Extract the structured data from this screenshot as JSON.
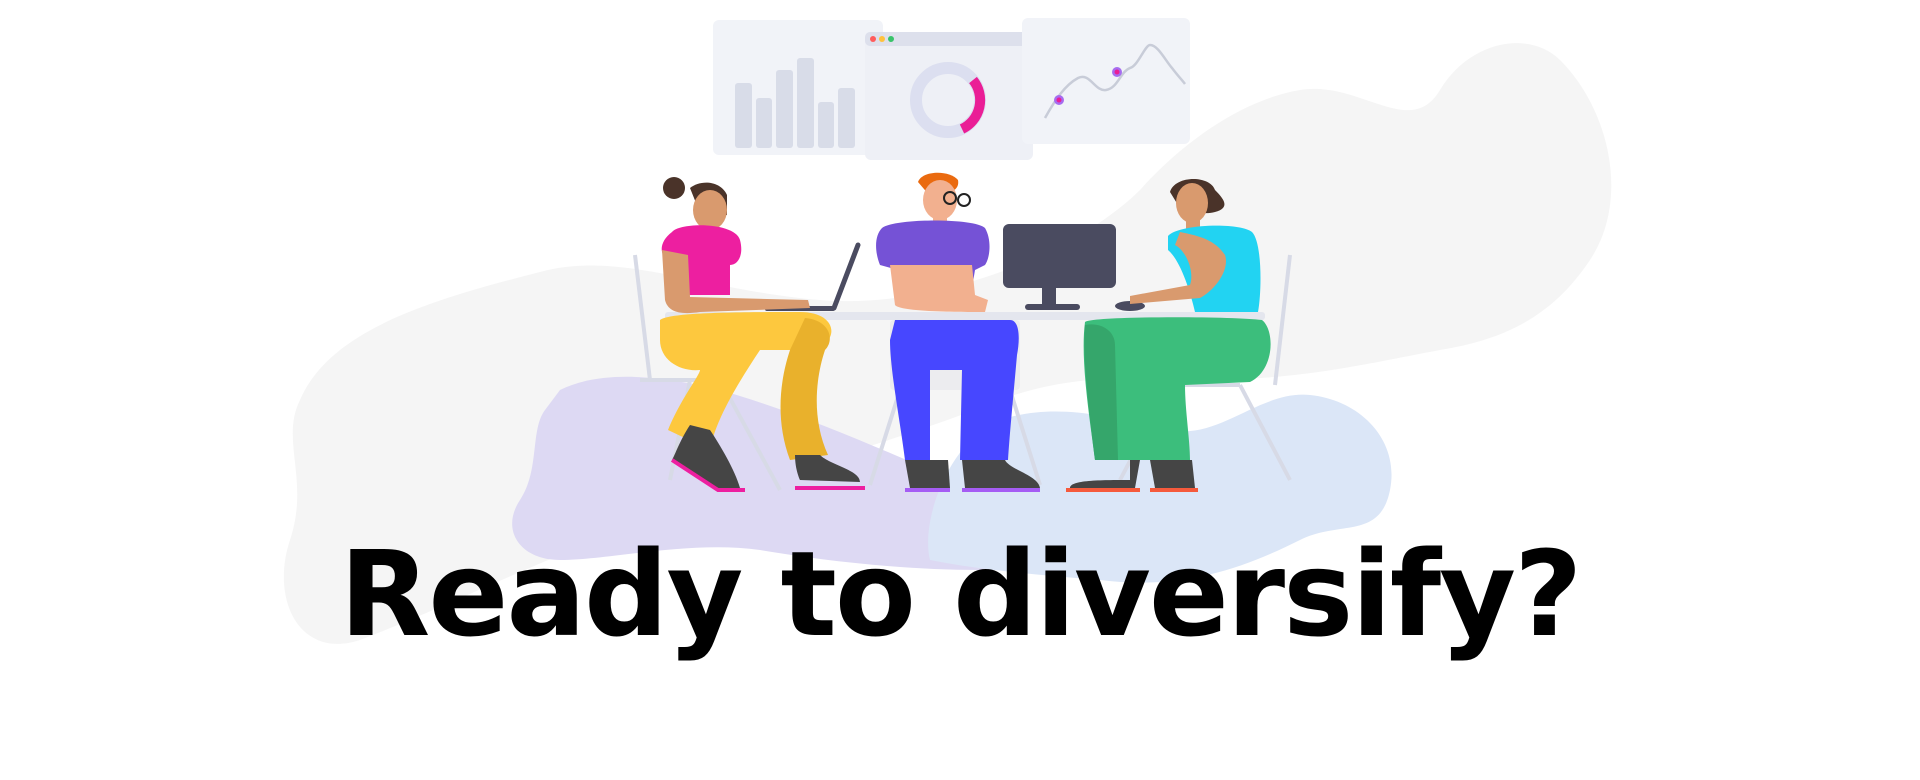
{
  "headline": {
    "text": "Ready to diversify?"
  },
  "illustration": {
    "subject": "three-people-working-at-desk-with-dashboard",
    "colors": {
      "background_blob": "#f5f5f5",
      "purple_blob": "#ddd9f3",
      "blue_blob": "#dbe6f7",
      "panel": "#f1f3f8",
      "panel_bar": "#dde0ec",
      "donut_accent": "#ea1e96",
      "chart_line": "#c8ccd8",
      "skin_light": "#f2b08f",
      "skin_medium": "#d99a6e",
      "person_left_top": "#ed1fa0",
      "person_left_pants": "#fdc83e",
      "person_middle_top": "#7552d6",
      "person_middle_pants": "#4747ff",
      "person_middle_hair": "#ea6a0f",
      "person_right_top": "#22d3f2",
      "person_right_pants": "#3cbe7c",
      "shoe": "#454545",
      "monitor": "#4a4b60"
    }
  }
}
